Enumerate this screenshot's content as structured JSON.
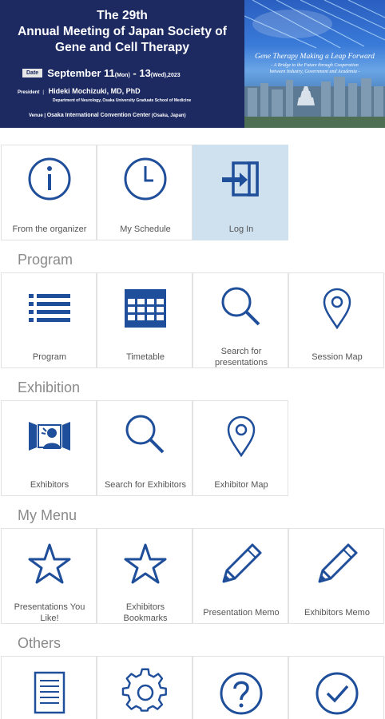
{
  "banner": {
    "title_line1": "The 29th",
    "title_line2": "Annual Meeting of Japan Society of",
    "title_line3": "Gene and Cell Therapy",
    "date_tag": "Date",
    "date_main": "September 11",
    "date_start_day": "(Mon)",
    "date_sep": " - 13",
    "date_end_day": "(Wed)",
    "date_year": ",2023",
    "president_label": "President",
    "president_name": "Hideki Mochizuki, MD, PhD",
    "president_dept": "Department of Neurology, Osaka University Graduate School of Medicine",
    "venue_label": "Venue",
    "venue_name": "Osaka International Convention Center",
    "venue_place": "(Osaka, Japan)",
    "theme_title": "Gene Therapy Making a Leap Forward",
    "theme_sub_line1": "- A Bridge to the Future through Cooperation",
    "theme_sub_line2": "between Industry, Government and Academia -"
  },
  "top_tiles": [
    {
      "label": "From the organizer",
      "icon": "info-icon"
    },
    {
      "label": "My Schedule",
      "icon": "clock-icon"
    },
    {
      "label": "Log In",
      "icon": "login-icon",
      "active": true
    }
  ],
  "sections": {
    "program": {
      "title": "Program",
      "tiles": [
        {
          "label": "Program",
          "icon": "list-icon"
        },
        {
          "label": "Timetable",
          "icon": "calendar-icon"
        },
        {
          "label_line1": "Search for",
          "label_line2": "presentations",
          "icon": "search-icon"
        },
        {
          "label": "Session Map",
          "icon": "map-pin-icon"
        }
      ]
    },
    "exhibition": {
      "title": "Exhibition",
      "tiles": [
        {
          "label": "Exhibitors",
          "icon": "exhibitor-booth-icon"
        },
        {
          "label": "Search for Exhibitors",
          "icon": "search-icon"
        },
        {
          "label": "Exhibitor Map",
          "icon": "map-pin-icon"
        }
      ]
    },
    "my_menu": {
      "title": "My Menu",
      "tiles": [
        {
          "label_line1": "Presentations You",
          "label_line2": "Like!",
          "icon": "star-icon"
        },
        {
          "label_line1": "Exhibitors",
          "label_line2": "Bookmarks",
          "icon": "star-icon"
        },
        {
          "label": "Presentation Memo",
          "icon": "pencil-icon"
        },
        {
          "label": "Exhibitors Memo",
          "icon": "pencil-icon"
        }
      ]
    },
    "others": {
      "title": "Others",
      "tiles": [
        {
          "icon": "document-icon"
        },
        {
          "icon": "gear-icon"
        },
        {
          "icon": "help-icon"
        },
        {
          "icon": "check-circle-icon"
        }
      ]
    }
  },
  "colors": {
    "icon": "#1f4e9a",
    "active_tile": "#cfe1ef",
    "banner_bg": "#1d2a62",
    "section_title": "#8a8a8a"
  }
}
